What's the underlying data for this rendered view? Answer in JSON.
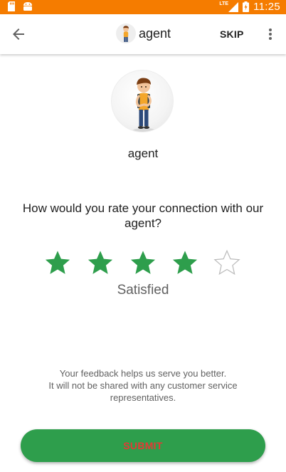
{
  "status_bar": {
    "time": "11:25",
    "network": "LTE",
    "icons": [
      "sd-card-icon",
      "android-icon",
      "signal-icon",
      "battery-charging-icon"
    ]
  },
  "app_bar": {
    "title": "agent",
    "skip_label": "SKIP",
    "icons": [
      "back-arrow-icon",
      "more-vert-icon"
    ]
  },
  "profile": {
    "name": "agent"
  },
  "rating": {
    "question": "How would you rate your connection with our agent?",
    "max_stars": 5,
    "selected_stars": 4,
    "label": "Satisfied",
    "colors": {
      "filled": "#2e9e4c",
      "empty": "#bdbdbd"
    }
  },
  "feedback": {
    "line1": "Your feedback helps us serve you better.",
    "line2": "It will not be shared with any customer service representatives."
  },
  "submit": {
    "label": "SUBMIT",
    "colors": {
      "background": "#2e9e4c",
      "text": "#e53935"
    }
  },
  "theme": {
    "status_bar": "#f57c00"
  }
}
